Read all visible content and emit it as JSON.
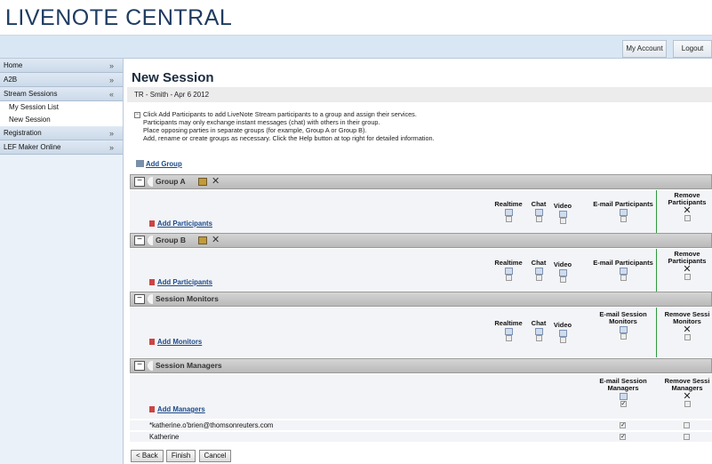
{
  "app": {
    "title": "LIVENOTE CENTRAL"
  },
  "topbar": {
    "my_account": "My Account",
    "logout": "Logout"
  },
  "sidebar": {
    "items": [
      {
        "label": "Home",
        "chev": "»"
      },
      {
        "label": "A2B",
        "chev": "»"
      },
      {
        "label": "Stream Sessions",
        "chev": "«"
      },
      {
        "label": "Registration",
        "chev": "»"
      },
      {
        "label": "LEF Maker Online",
        "chev": "»"
      }
    ],
    "sub_items": [
      "My Session List",
      "New Session"
    ]
  },
  "page": {
    "title": "New Session",
    "breadcrumb": "TR - Smith - Apr 6 2012",
    "info_lines": [
      "Click Add Participants to add LiveNote Stream participants to a group and assign their services.",
      "Participants may only exchange instant messages (chat) with others in their group.",
      "Place opposing parties in separate groups (for example, Group A or Group B).",
      "Add, rename or create groups as necessary. Click the Help button at top right for detailed information."
    ],
    "add_group": "Add Group"
  },
  "columns": {
    "realtime": "Realtime",
    "chat": "Chat",
    "video": "Video",
    "email_participants": "E-mail Participants",
    "remove_participants_1": "Remove",
    "remove_participants_2": "Participants",
    "email_session_monitors_1": "E-mail Session",
    "email_session_monitors_2": "Monitors",
    "remove_session_monitors_1": "Remove Sessi",
    "remove_session_monitors_2": "Monitors",
    "email_session_managers_1": "E-mail Session",
    "email_session_managers_2": "Managers",
    "remove_session_managers_1": "Remove Sessi",
    "remove_session_managers_2": "Managers"
  },
  "sections": {
    "group_a": {
      "name": "Group A",
      "add_label": "Add Participants"
    },
    "group_b": {
      "name": "Group B",
      "add_label": "Add Participants"
    },
    "monitors": {
      "name": "Session Monitors",
      "add_label": "Add Monitors"
    },
    "managers": {
      "name": "Session Managers",
      "add_label": "Add Managers",
      "rows": [
        {
          "name": "*katherine.o'brien@thomsonreuters.com",
          "email_checked": true,
          "remove_checked": false
        },
        {
          "name": "Katherine",
          "email_checked": true,
          "remove_checked": false
        }
      ]
    }
  },
  "footer": {
    "back": "< Back",
    "finish": "Finish",
    "cancel": "Cancel"
  }
}
